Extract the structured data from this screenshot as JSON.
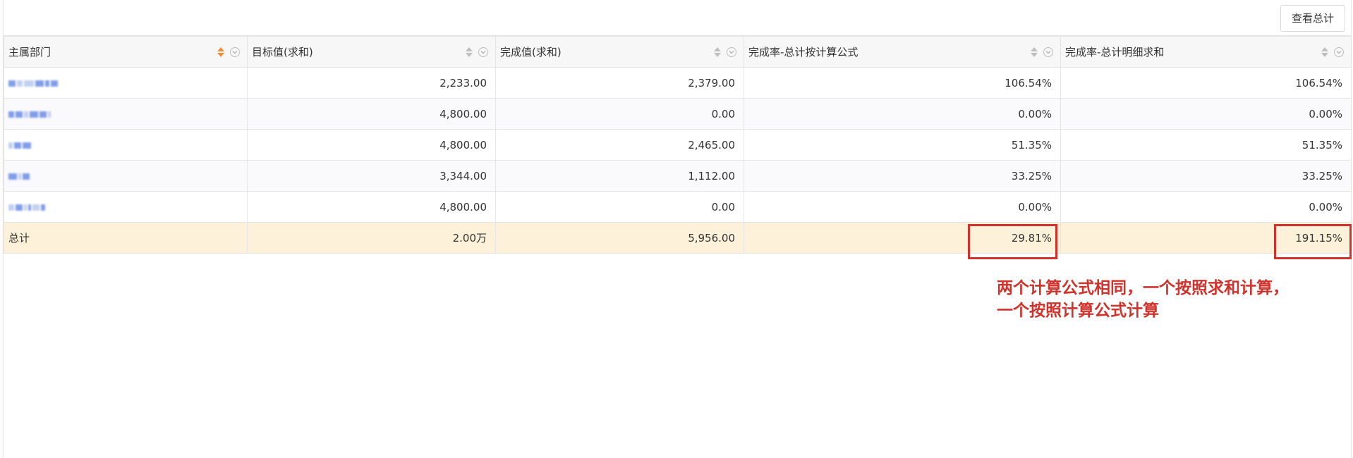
{
  "toolbar": {
    "view_total_label": "查看总计"
  },
  "table": {
    "columns": [
      {
        "label": "主属部门",
        "sort_active": true
      },
      {
        "label": "目标值(求和)",
        "sort_active": false
      },
      {
        "label": "完成值(求和)",
        "sort_active": false
      },
      {
        "label": "完成率-总计按计算公式",
        "sort_active": false
      },
      {
        "label": "完成率-总计明细求和",
        "sort_active": false
      }
    ],
    "rows": [
      {
        "target": "2,233.00",
        "done": "2,379.00",
        "rate_formula": "106.54%",
        "rate_sum": "106.54%"
      },
      {
        "target": "4,800.00",
        "done": "0.00",
        "rate_formula": "0.00%",
        "rate_sum": "0.00%"
      },
      {
        "target": "4,800.00",
        "done": "2,465.00",
        "rate_formula": "51.35%",
        "rate_sum": "51.35%"
      },
      {
        "target": "3,344.00",
        "done": "1,112.00",
        "rate_formula": "33.25%",
        "rate_sum": "33.25%"
      },
      {
        "target": "4,800.00",
        "done": "0.00",
        "rate_formula": "0.00%",
        "rate_sum": "0.00%"
      }
    ],
    "total": {
      "label": "总计",
      "target": "2.00万",
      "done": "5,956.00",
      "rate_formula": "29.81%",
      "rate_sum": "191.15%"
    }
  },
  "annotation": {
    "line1": "两个计算公式相同，一个按照求和计算，",
    "line2": "一个按照计算公式计算"
  },
  "colors": {
    "highlight": "#d0322c",
    "sort_active": "#ef8c3c",
    "total_row_bg": "#fdf2d9"
  }
}
